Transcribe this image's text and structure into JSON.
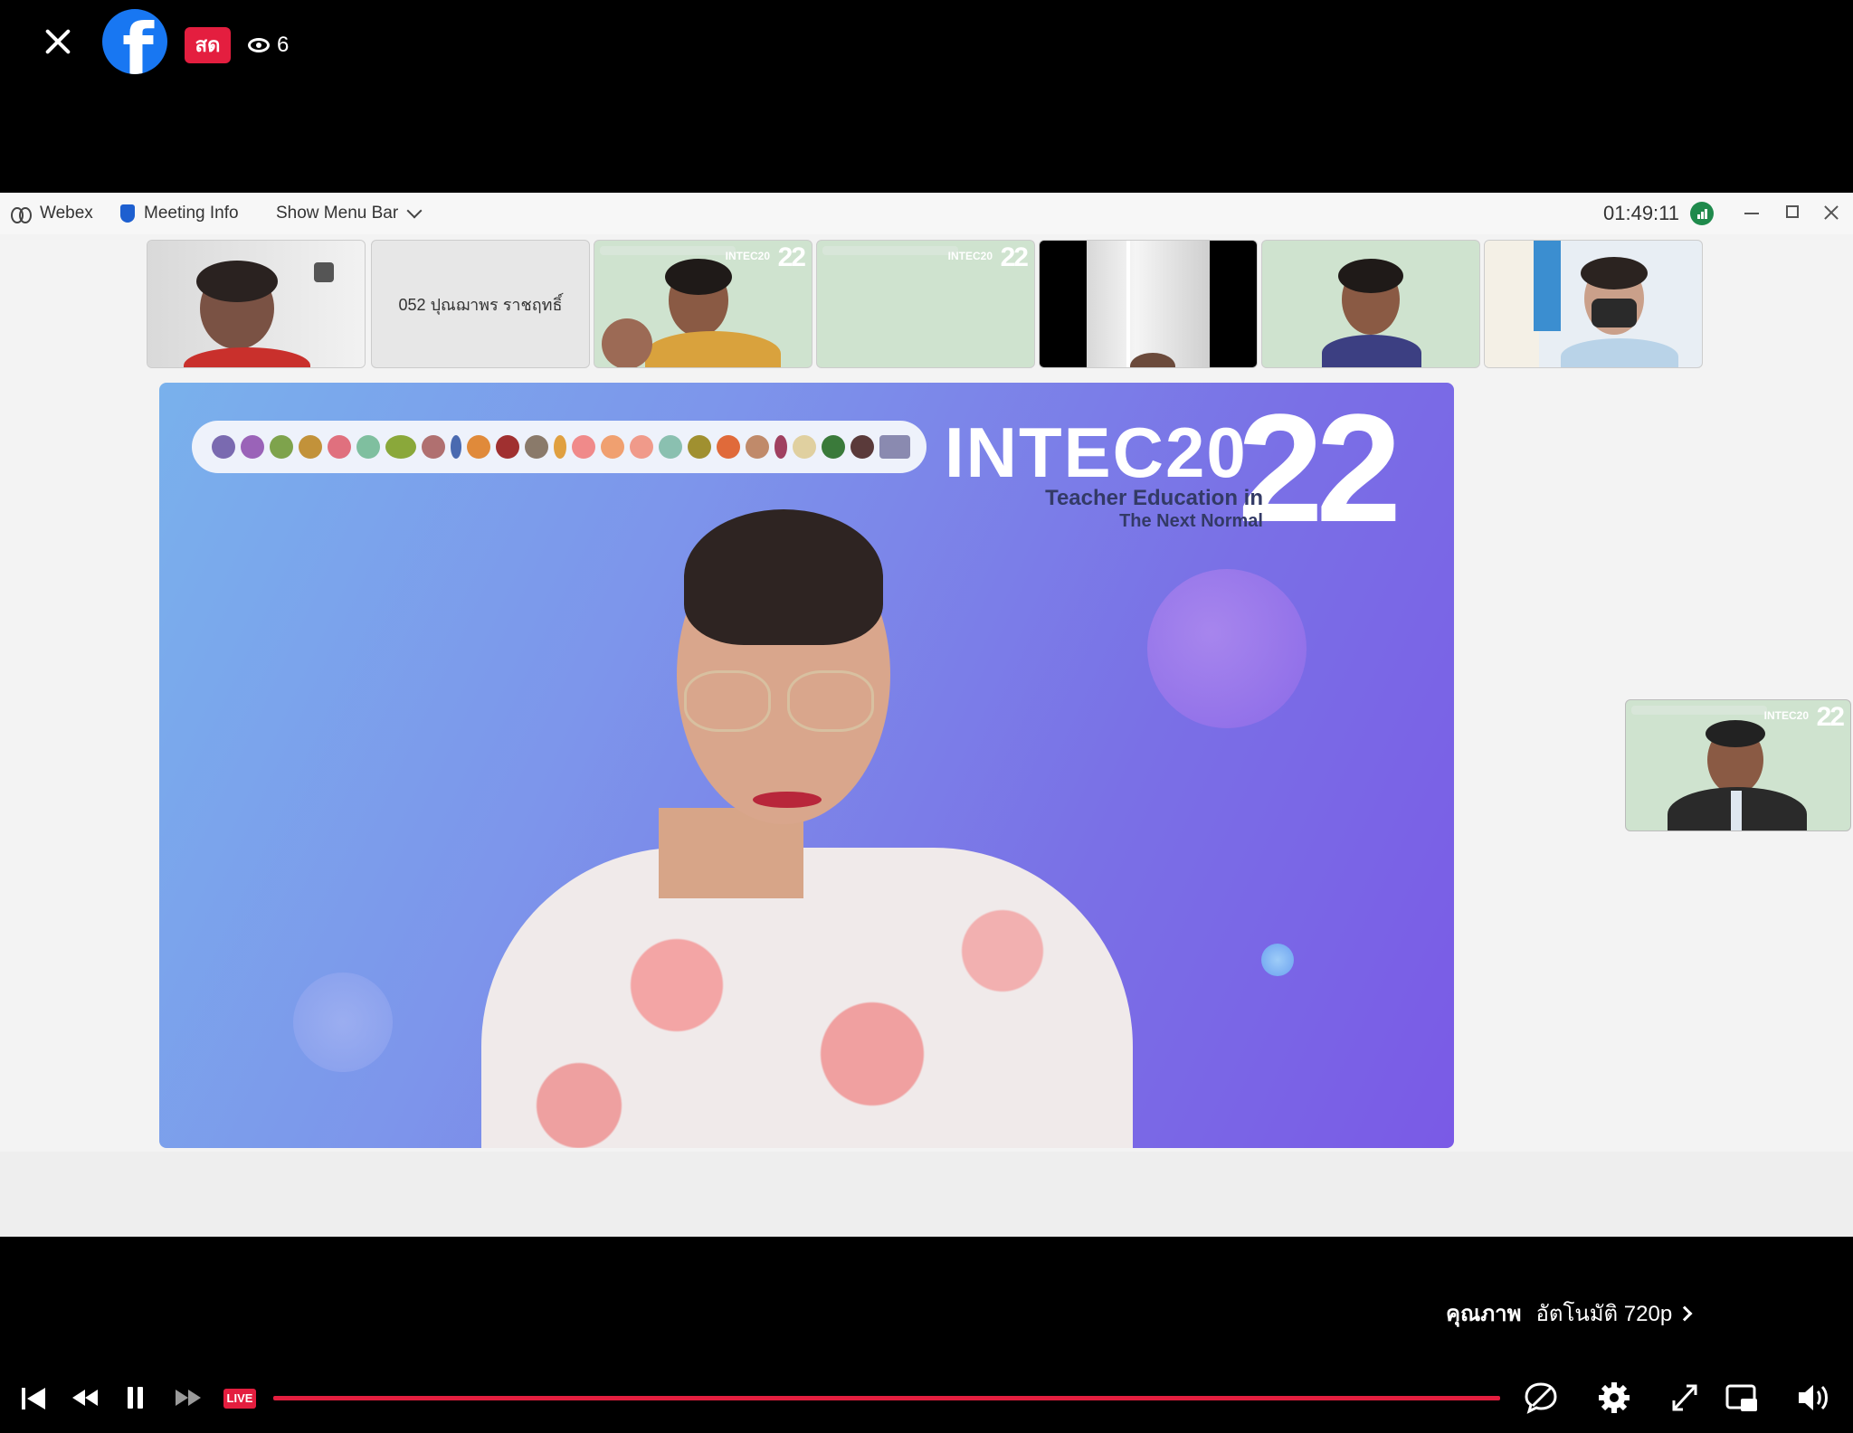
{
  "player": {
    "live_badge": "สด",
    "viewer_count": "6",
    "quality_label": "คุณภาพ",
    "quality_value": "อัตโนมัติ 720p",
    "live_tag": "LIVE",
    "progress": 1.0
  },
  "webex": {
    "app_name": "Webex",
    "meeting_info": "Meeting Info",
    "show_menu_bar": "Show Menu Bar",
    "elapsed_time": "01:49:11"
  },
  "participants": [
    {
      "kind": "video"
    },
    {
      "kind": "name",
      "name": "052 ปุณฌาพร ราชฤทธิ์"
    },
    {
      "kind": "video"
    },
    {
      "kind": "video"
    },
    {
      "kind": "video"
    },
    {
      "kind": "video"
    },
    {
      "kind": "video"
    }
  ],
  "stage": {
    "title_main": "INTEC20",
    "title_year": "22",
    "subtitle_line1": "Teacher Education in",
    "subtitle_line2": "The Next Normal"
  },
  "colors": {
    "facebook_blue": "#1877f2",
    "live_red": "#e41e3f",
    "stage_gradient_start": "#79b1ec",
    "stage_gradient_end": "#7a5ae6"
  }
}
